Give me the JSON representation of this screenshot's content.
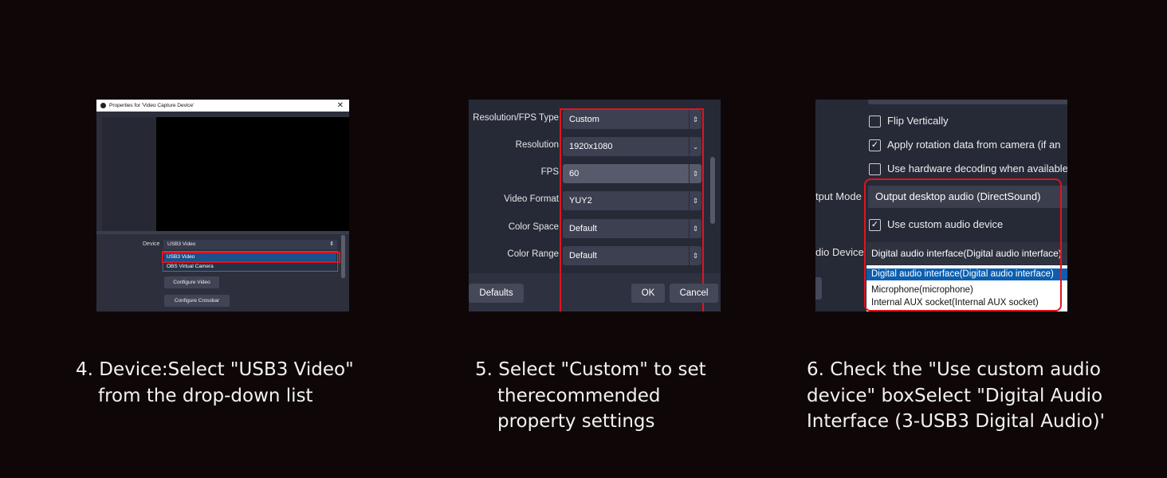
{
  "panel1": {
    "window_title": "Properties for 'Video Capture Device'",
    "close_glyph": "✕",
    "device_label": "Device",
    "device_value": "USB3 Video",
    "select_arrow": "⇕",
    "options": [
      "USB3 Video",
      "OBS Virtual Camera"
    ],
    "buttons": [
      "Configure Video",
      "Configure Crossbar"
    ],
    "highlight_color": "#e0141f"
  },
  "panel2": {
    "rows": [
      {
        "label": "Resolution/FPS Type",
        "value": "Custom",
        "arrow": "⇕"
      },
      {
        "label": "Resolution",
        "value": "1920x1080",
        "arrow": "⌄"
      },
      {
        "label": "FPS",
        "value": "60",
        "arrow": "⇕"
      },
      {
        "label": "Video Format",
        "value": "YUY2",
        "arrow": "⇕"
      },
      {
        "label": "Color Space",
        "value": "Default",
        "arrow": "⇕"
      },
      {
        "label": "Color Range",
        "value": "Default",
        "arrow": "⇕"
      }
    ],
    "buttons": {
      "defaults": "Defaults",
      "ok": "OK",
      "cancel": "Cancel"
    }
  },
  "panel3": {
    "checkboxes": [
      {
        "label": "Flip Vertically",
        "checked": false
      },
      {
        "label": "Apply rotation data from camera (if an",
        "checked": true
      },
      {
        "label": "Use hardware decoding when available",
        "checked": false
      },
      {
        "label": "Use custom audio device",
        "checked": true
      }
    ],
    "check_glyph": "✓",
    "output_mode_label": "tput Mode",
    "output_mode_value": "Output desktop audio (DirectSound)",
    "audio_device_label": "dio Device",
    "audio_device_value": "Digital audio interface(Digital audio interface)",
    "audio_options": [
      "Digital audio interface(Digital audio interface)",
      "Microphone(microphone)",
      "Internal AUX socket(Internal AUX socket)"
    ]
  },
  "captions": {
    "step4": [
      "4. Device:Select \"USB3 Video\"",
      "from the drop-down list"
    ],
    "step5": [
      "5. Select \"Custom\" to set",
      "therecommended",
      "property settings"
    ],
    "step6": [
      "6. Check the \"Use custom audio",
      "device\" boxSelect \"Digital Audio",
      "Interface (3-USB3 Digital Audio)'"
    ]
  }
}
